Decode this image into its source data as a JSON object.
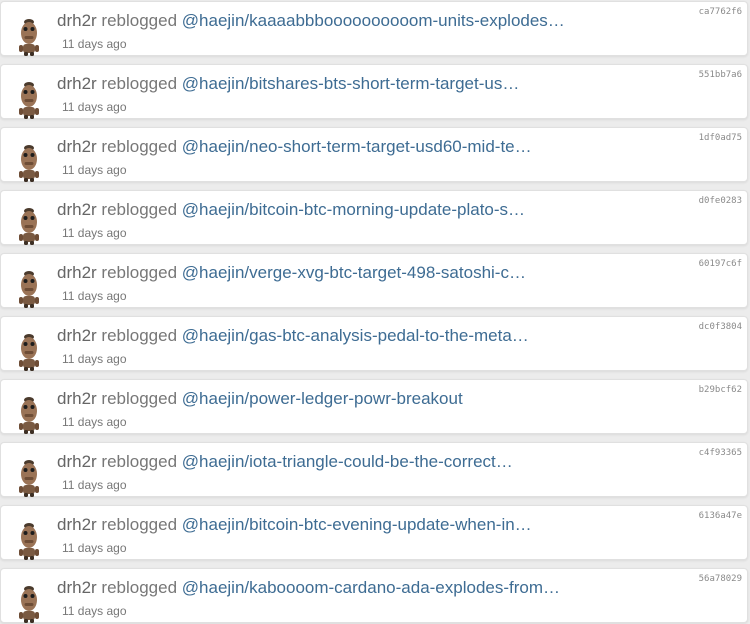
{
  "feed": {
    "items": [
      {
        "author": "drh2r",
        "verb": "reblogged",
        "link": "@haejin/kaaaabbboooooooooom-units-explodes…",
        "time": "11 days ago",
        "hash": "ca7762f6"
      },
      {
        "author": "drh2r",
        "verb": "reblogged",
        "link": "@haejin/bitshares-bts-short-term-target-us…",
        "time": "11 days ago",
        "hash": "551bb7a6"
      },
      {
        "author": "drh2r",
        "verb": "reblogged",
        "link": "@haejin/neo-short-term-target-usd60-mid-te…",
        "time": "11 days ago",
        "hash": "1df0ad75"
      },
      {
        "author": "drh2r",
        "verb": "reblogged",
        "link": "@haejin/bitcoin-btc-morning-update-plato-s…",
        "time": "11 days ago",
        "hash": "d0fe0283"
      },
      {
        "author": "drh2r",
        "verb": "reblogged",
        "link": "@haejin/verge-xvg-btc-target-498-satoshi-c…",
        "time": "11 days ago",
        "hash": "60197c6f"
      },
      {
        "author": "drh2r",
        "verb": "reblogged",
        "link": "@haejin/gas-btc-analysis-pedal-to-the-meta…",
        "time": "11 days ago",
        "hash": "dc0f3804"
      },
      {
        "author": "drh2r",
        "verb": "reblogged",
        "link": "@haejin/power-ledger-powr-breakout",
        "time": "11 days ago",
        "hash": "b29bcf62"
      },
      {
        "author": "drh2r",
        "verb": "reblogged",
        "link": "@haejin/iota-triangle-could-be-the-correct…",
        "time": "11 days ago",
        "hash": "c4f93365"
      },
      {
        "author": "drh2r",
        "verb": "reblogged",
        "link": "@haejin/bitcoin-btc-evening-update-when-in…",
        "time": "11 days ago",
        "hash": "6136a47e"
      },
      {
        "author": "drh2r",
        "verb": "reblogged",
        "link": "@haejin/kaboooom-cardano-ada-explodes-from…",
        "time": "11 days ago",
        "hash": "56a78029"
      }
    ]
  },
  "colors": {
    "link": "#3e6c93",
    "text": "#666666",
    "background": "#ececec",
    "card": "#ffffff"
  },
  "icons": {
    "avatar": "robot-avatar-icon"
  }
}
